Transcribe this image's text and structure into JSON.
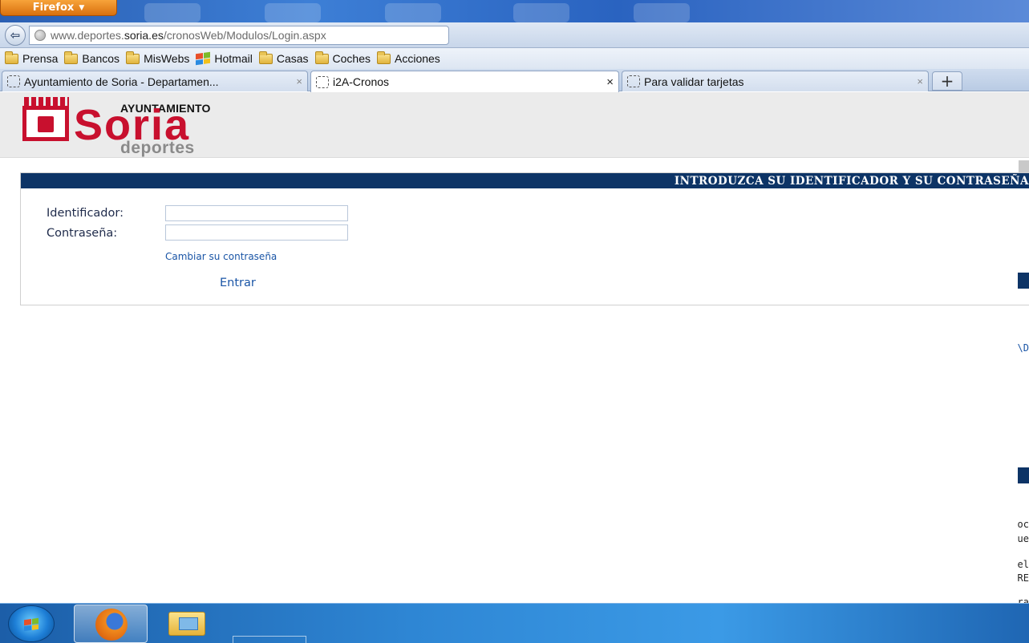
{
  "browser": {
    "menu_label": "Firefox",
    "menu_arrow": "▼",
    "back_glyph": "⇦",
    "url": {
      "pre": "www.deportes.",
      "domain": "soria.es",
      "post": "/cronosWeb/Modulos/Login.aspx"
    },
    "bookmarks": [
      {
        "label": "Prensa",
        "icon": "folder-icon"
      },
      {
        "label": "Bancos",
        "icon": "folder-icon"
      },
      {
        "label": "MisWebs",
        "icon": "folder-icon"
      },
      {
        "label": "Hotmail",
        "icon": "windows-icon"
      },
      {
        "label": "Casas",
        "icon": "folder-icon"
      },
      {
        "label": "Coches",
        "icon": "folder-icon"
      },
      {
        "label": "Acciones",
        "icon": "folder-icon"
      }
    ],
    "tabs": [
      {
        "label": "Ayuntamiento de Soria - Departamen...",
        "close": "×",
        "active": false
      },
      {
        "label": "i2A-Cronos",
        "close": "×",
        "active": true
      },
      {
        "label": "Para validar tarjetas",
        "close": "×",
        "active": false
      }
    ],
    "new_tab_glyph": "+"
  },
  "page": {
    "logo": {
      "top_text": "AYUNTAMIENTO",
      "main_text": "Soria",
      "sub_text": "deportes"
    },
    "login": {
      "heading": "INTRODUZCA SU IDENTIFICADOR Y SU CONTRASEÑA",
      "identifier_label": "Identificador:",
      "identifier_value": "",
      "password_label": "Contraseña:",
      "password_value": "",
      "change_password_link": "Cambiar su contraseña",
      "submit_link": "Entrar"
    },
    "edge_fragments": [
      "\\D",
      "oc",
      "ue",
      "el",
      "RE",
      "ra"
    ]
  },
  "colors": {
    "brand_red": "#c8102e",
    "header_navy": "#0d3466",
    "link_blue": "#1a55a6"
  }
}
